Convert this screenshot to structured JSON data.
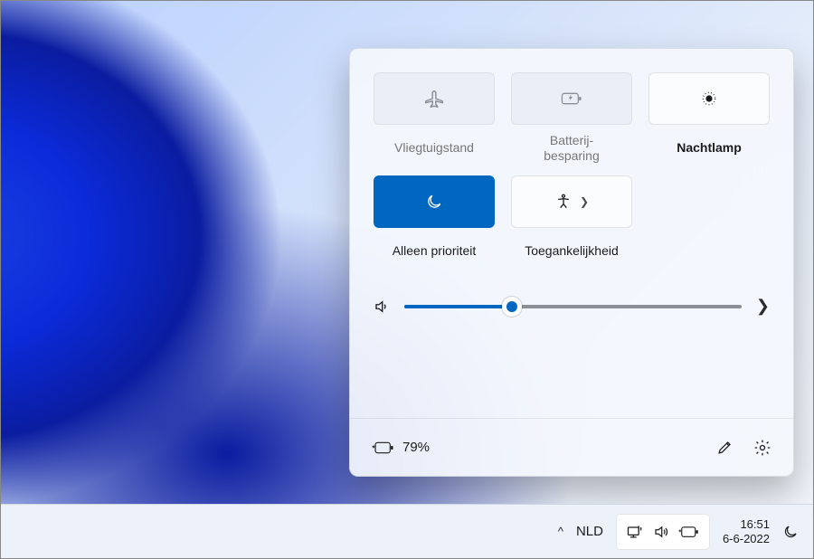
{
  "panel": {
    "tiles": [
      {
        "label": "Vliegtuigstand",
        "icon": "airplane-icon",
        "state": "disabled"
      },
      {
        "label": "Batterij-\nbesparing",
        "icon": "battery-saver-icon",
        "state": "disabled"
      },
      {
        "label": "Nachtlamp",
        "icon": "night-light-icon",
        "state": "off"
      },
      {
        "label": "Alleen prioriteit",
        "icon": "moon-icon",
        "state": "active"
      },
      {
        "label": "Toegankelijkheid",
        "icon": "accessibility-icon",
        "state": "off-expand"
      }
    ],
    "volume_percent": 32,
    "footer": {
      "battery_text": "79%"
    }
  },
  "taskbar": {
    "chevron": "˄",
    "lang": "NLD",
    "time": "16:51",
    "date": "6-6-2022"
  },
  "colors": {
    "accent": "#0067c0"
  }
}
